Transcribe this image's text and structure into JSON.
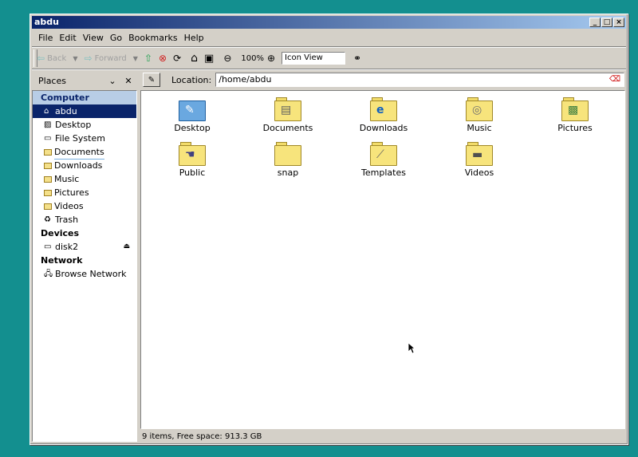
{
  "window": {
    "title": "abdu"
  },
  "menu": [
    "File",
    "Edit",
    "View",
    "Go",
    "Bookmarks",
    "Help"
  ],
  "toolbar": {
    "back": "Back",
    "forward": "Forward",
    "zoom": "100%",
    "view_mode": "Icon View"
  },
  "places": {
    "label": "Places"
  },
  "location": {
    "label": "Location:",
    "value": "/home/abdu"
  },
  "sidebar": {
    "computer_header": "Computer",
    "computer_items": [
      {
        "label": "abdu",
        "icon": "home-icon"
      },
      {
        "label": "Desktop",
        "icon": "desktop-icon"
      },
      {
        "label": "File System",
        "icon": "drive-icon"
      },
      {
        "label": "Documents",
        "icon": "folder-icon"
      },
      {
        "label": "Downloads",
        "icon": "folder-icon"
      },
      {
        "label": "Music",
        "icon": "folder-icon"
      },
      {
        "label": "Pictures",
        "icon": "folder-icon"
      },
      {
        "label": "Videos",
        "icon": "folder-icon"
      },
      {
        "label": "Trash",
        "icon": "trash-icon"
      }
    ],
    "devices_header": "Devices",
    "devices": [
      {
        "label": "disk2",
        "icon": "drive-icon"
      }
    ],
    "network_header": "Network",
    "network": [
      {
        "label": "Browse Network",
        "icon": "network-icon"
      }
    ]
  },
  "files": [
    {
      "name": "Desktop",
      "icon": "desktop-folder-icon"
    },
    {
      "name": "Documents",
      "icon": "documents-folder-icon"
    },
    {
      "name": "Downloads",
      "icon": "downloads-folder-icon"
    },
    {
      "name": "Music",
      "icon": "music-folder-icon"
    },
    {
      "name": "Pictures",
      "icon": "pictures-folder-icon"
    },
    {
      "name": "Public",
      "icon": "public-folder-icon"
    },
    {
      "name": "snap",
      "icon": "folder-icon"
    },
    {
      "name": "Templates",
      "icon": "templates-folder-icon"
    },
    {
      "name": "Videos",
      "icon": "videos-folder-icon"
    }
  ],
  "status": "9 items, Free space: 913.3 GB",
  "colors": {
    "desktop": "#138f8f",
    "selection": "#0a246a",
    "titlebar": "#0a246a"
  }
}
